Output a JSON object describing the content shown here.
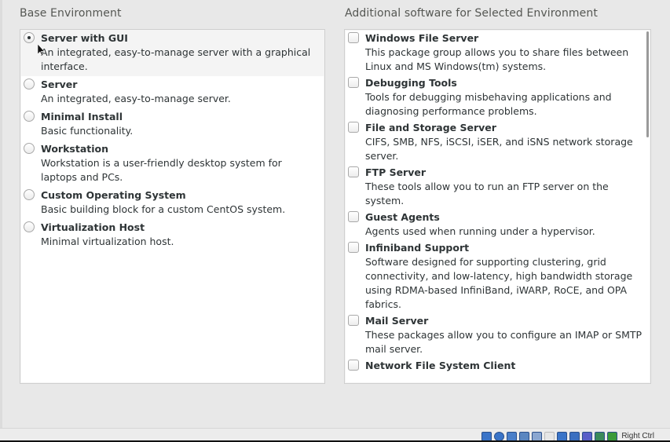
{
  "base_environment": {
    "title": "Base Environment",
    "selected_index": 0,
    "items": [
      {
        "name": "Server with GUI",
        "description": "An integrated, easy-to-manage server with a graphical interface.",
        "selected": true
      },
      {
        "name": "Server",
        "description": "An integrated, easy-to-manage server.",
        "selected": false
      },
      {
        "name": "Minimal Install",
        "description": "Basic functionality.",
        "selected": false
      },
      {
        "name": "Workstation",
        "description": "Workstation is a user-friendly desktop system for laptops and PCs.",
        "selected": false
      },
      {
        "name": "Custom Operating System",
        "description": "Basic building block for a custom CentOS system.",
        "selected": false
      },
      {
        "name": "Virtualization Host",
        "description": "Minimal virtualization host.",
        "selected": false
      }
    ]
  },
  "additional_software": {
    "title": "Additional software for Selected Environment",
    "items": [
      {
        "name": "Windows File Server",
        "description": "This package group allows you to share files between Linux and MS Windows(tm) systems.",
        "checked": false
      },
      {
        "name": "Debugging Tools",
        "description": "Tools for debugging misbehaving applications and diagnosing performance problems.",
        "checked": false
      },
      {
        "name": "File and Storage Server",
        "description": "CIFS, SMB, NFS, iSCSI, iSER, and iSNS network storage server.",
        "checked": false
      },
      {
        "name": "FTP Server",
        "description": "These tools allow you to run an FTP server on the system.",
        "checked": false
      },
      {
        "name": "Guest Agents",
        "description": "Agents used when running under a hypervisor.",
        "checked": false
      },
      {
        "name": "Infiniband Support",
        "description": "Software designed for supporting clustering, grid connectivity, and low-latency, high bandwidth storage using RDMA-based InfiniBand, iWARP, RoCE, and OPA fabrics.",
        "checked": false
      },
      {
        "name": "Mail Server",
        "description": "These packages allow you to configure an IMAP or SMTP mail server.",
        "checked": false
      },
      {
        "name": "Network File System Client",
        "description": "",
        "checked": false
      }
    ]
  },
  "statusbar": {
    "host_key_label": "Right Ctrl",
    "icons": [
      "hard-disk-icon",
      "optical-drive-icon",
      "audio-icon",
      "network-icon",
      "usb-icon",
      "shared-folder-icon",
      "display-icon",
      "video-capture-icon",
      "vm-icon",
      "mouse-integration-icon",
      "keyboard-capture-icon"
    ],
    "icon_colors": [
      "#3a74c8",
      "#3a74c8",
      "#4a7fc9",
      "#5a86c0",
      "#8aa6d0",
      "#e6e6e6",
      "#3a74c8",
      "#3a6fc0",
      "#5a5fc8",
      "#3a8a5a",
      "#3a9a3a"
    ]
  }
}
